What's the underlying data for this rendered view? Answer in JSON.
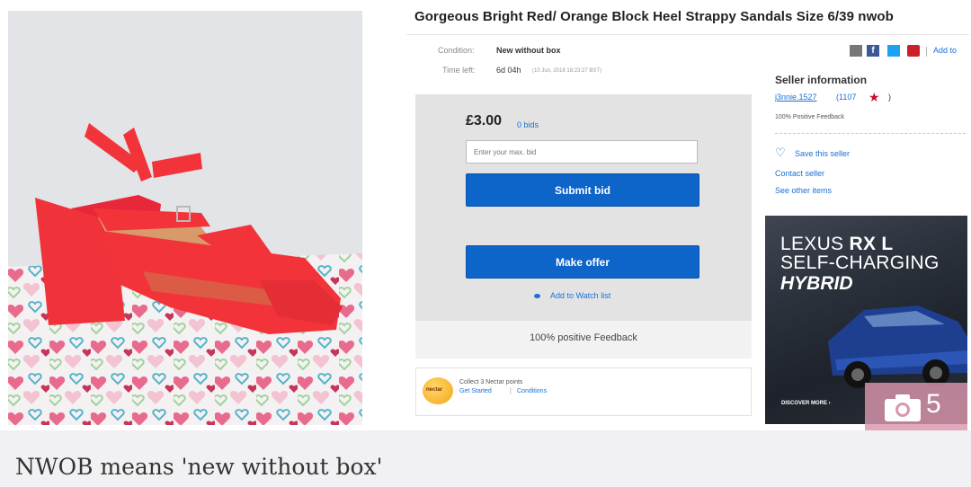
{
  "listing": {
    "title": "Gorgeous Bright Red/ Orange Block Heel Strappy Sandals Size 6/39 nwob",
    "condition_label": "Condition:",
    "condition_value": "New without box",
    "time_left_label": "Time left:",
    "time_left_value": "6d 04h",
    "time_left_detail": "(10 Jun, 2018   18:23:27 BST)"
  },
  "share": {
    "add_to_label": "Add to",
    "colors": {
      "email": "#777777",
      "facebook": "#3b5998",
      "twitter": "#1da1f2",
      "pinterest": "#cb2027"
    }
  },
  "bid": {
    "price": "£3.00",
    "bids": "0 bids",
    "max_bid_placeholder": "Enter your max. bid",
    "submit_label": "Submit bid",
    "make_offer_label": "Make offer",
    "watch_label": "Add to Watch list",
    "positive_feedback": "100% positive Feedback"
  },
  "nectar": {
    "logo_text": "nectar",
    "line1": "Collect 3 Nectar points",
    "get_started": "Get Started",
    "conditions": "Conditions"
  },
  "seller": {
    "heading": "Seller information",
    "username": "j3nnie.1527",
    "score": "(1107",
    "score_close": ")",
    "feedback": "100% Positive Feedback",
    "save_label": "Save this seller",
    "contact_label": "Contact seller",
    "see_items_label": "See other items"
  },
  "ad": {
    "brand": "LEXUS",
    "model": "RX L",
    "line2": "SELF-CHARGING",
    "line3": "HYBRID",
    "cta": "DISCOVER MORE ›"
  },
  "photo_count": "5",
  "caption": "NWOB means 'new without box'",
  "colors": {
    "button_blue": "#0d64c9",
    "link_blue": "#1b6fd6",
    "sandal_red": "#f2343a"
  }
}
